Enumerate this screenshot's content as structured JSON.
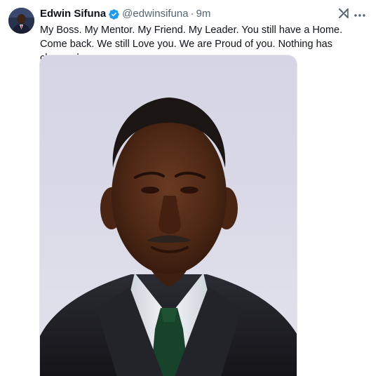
{
  "author": {
    "name": "Edwin Sifuna",
    "handle": "@edwinsifuna",
    "separator": "·",
    "time": "9m",
    "verified": true
  },
  "tweet": {
    "text": "My Boss. My Mentor. My Friend. My Leader. You still have a Home. Come back. We still Love you. We are Proud of you. Nothing has changed."
  },
  "icons": {
    "verified": "verified-badge-icon",
    "grok": "grok-icon",
    "more": "more-options-icon"
  },
  "colors": {
    "verified_blue": "#1d9bf0",
    "secondary_text": "#536471",
    "primary_text": "#0f1419"
  }
}
